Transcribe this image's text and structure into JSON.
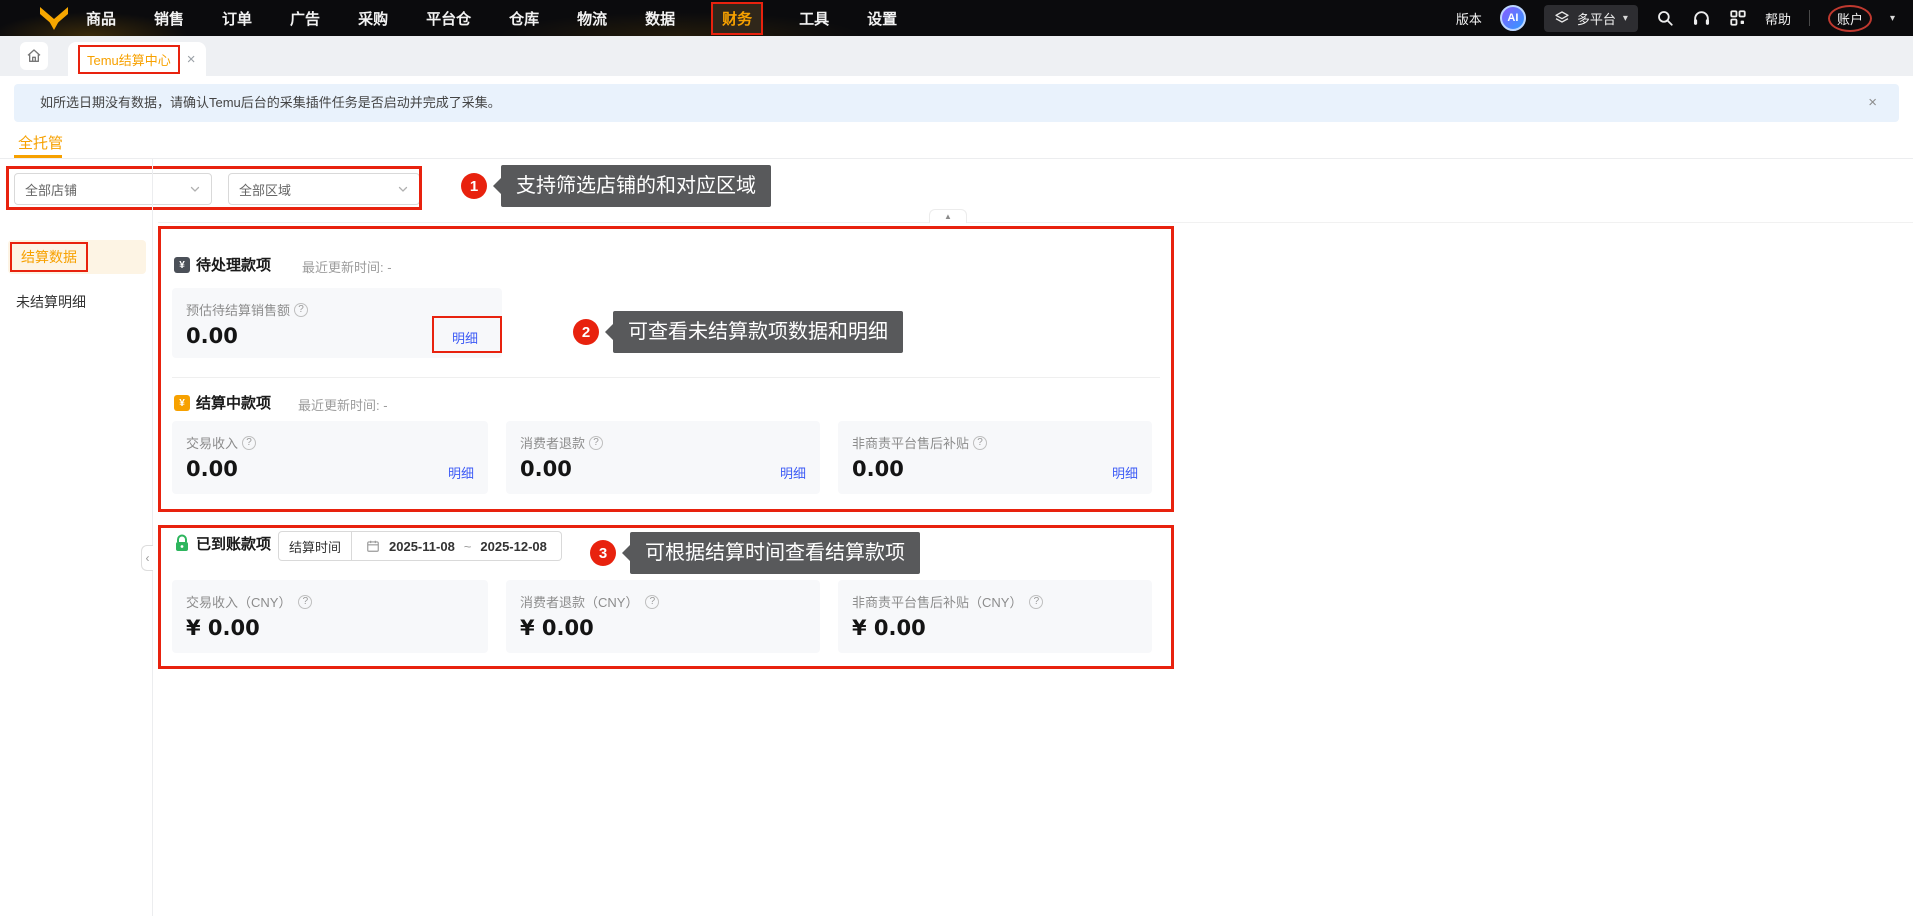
{
  "nav": {
    "items": [
      {
        "label": "商品"
      },
      {
        "label": "销售"
      },
      {
        "label": "订单"
      },
      {
        "label": "广告"
      },
      {
        "label": "采购"
      },
      {
        "label": "平台仓"
      },
      {
        "label": "仓库"
      },
      {
        "label": "物流"
      },
      {
        "label": "数据"
      },
      {
        "label": "财务",
        "active": true
      },
      {
        "label": "工具"
      },
      {
        "label": "设置"
      }
    ],
    "version_label": "版本",
    "ai_badge_label": "AI",
    "platform_switcher_label": "多平台",
    "help_label": "帮助",
    "account_label": "账户"
  },
  "icons": {
    "caret_glyph": "▾",
    "close_glyph": "×",
    "help_glyph": "?",
    "yen_glyph": "¥",
    "collapse_up_glyph": "▲",
    "collapse_left_glyph": "‹"
  },
  "tab_bar": {
    "active_tab_label": "Temu结算中心"
  },
  "notice_banner": {
    "text": "如所选日期没有数据，请确认Temu后台的采集插件任务是否启动并完成了采集。"
  },
  "page_tabs": {
    "active_label": "全托管"
  },
  "filters": {
    "shop_select_value": "全部店铺",
    "region_select_value": "全部区域"
  },
  "sidebar": {
    "items": [
      {
        "label": "结算数据",
        "active": true
      },
      {
        "label": "未结算明细",
        "active": false
      }
    ]
  },
  "annotations": [
    {
      "number": "1",
      "text": "支持筛选店铺的和对应区域"
    },
    {
      "number": "2",
      "text": "可查看未结算款项数据和明细"
    },
    {
      "number": "3",
      "text": "可根据结算时间查看结算款项"
    }
  ],
  "pending_section": {
    "title": "待处理款项",
    "updated_label": "最近更新时间: -",
    "card": {
      "label": "预估待结算销售额",
      "value": "0.00",
      "detail_link": "明细"
    }
  },
  "settling_section": {
    "title": "结算中款项",
    "updated_label": "最近更新时间: -",
    "cards": [
      {
        "label": "交易收入",
        "value": "0.00",
        "detail_link": "明细"
      },
      {
        "label": "消费者退款",
        "value": "0.00",
        "detail_link": "明细"
      },
      {
        "label": "非商责平台售后补贴",
        "value": "0.00",
        "detail_link": "明细"
      }
    ]
  },
  "received_section": {
    "title": "已到账款项",
    "time_filter_label": "结算时间",
    "date_start": "2025-11-08",
    "date_separator": "~",
    "date_end": "2025-12-08",
    "cards": [
      {
        "label": "交易收入（CNY）",
        "value": "¥ 0.00"
      },
      {
        "label": "消费者退款（CNY）",
        "value": "¥ 0.00"
      },
      {
        "label": "非商责平台售后补贴（CNY）",
        "value": "¥ 0.00"
      }
    ]
  },
  "colors": {
    "brand_orange": "#f7a100",
    "annotation_red": "#e8220e",
    "link_blue": "#3d5bf5",
    "tooltip_gray": "#58595b",
    "banner_blue": "#e9f2fc",
    "sidebar_active_bg": "#fdf4e4"
  }
}
